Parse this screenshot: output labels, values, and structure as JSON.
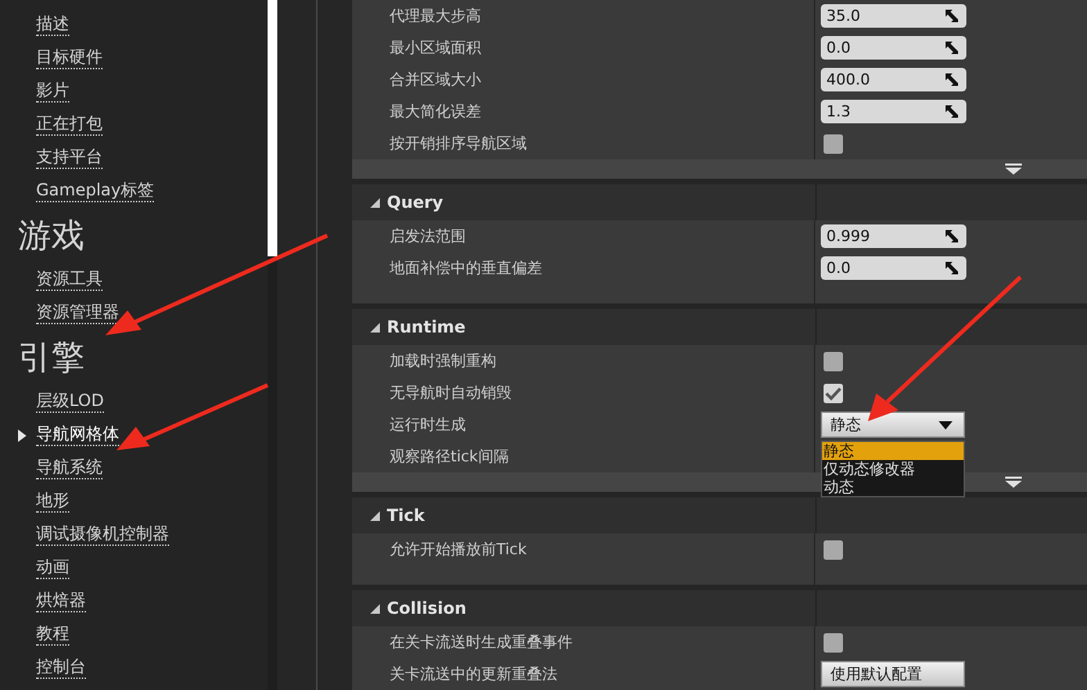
{
  "sidebar": {
    "sections": [
      {
        "items": [
          {
            "label": "描述",
            "selected": false
          },
          {
            "label": "目标硬件",
            "selected": false
          },
          {
            "label": "影片",
            "selected": false
          },
          {
            "label": "正在打包",
            "selected": false
          },
          {
            "label": "支持平台",
            "selected": false
          },
          {
            "label": "Gameplay标签",
            "selected": false
          }
        ]
      },
      {
        "heading": "游戏",
        "items": [
          {
            "label": "资源工具",
            "selected": false
          },
          {
            "label": "资源管理器",
            "selected": false
          }
        ]
      },
      {
        "heading": "引擎",
        "items": [
          {
            "label": "层级LOD",
            "selected": false
          },
          {
            "label": "导航网格体",
            "selected": true
          },
          {
            "label": "导航系统",
            "selected": false
          },
          {
            "label": "地形",
            "selected": false
          },
          {
            "label": "调试摄像机控制器",
            "selected": false
          },
          {
            "label": "动画",
            "selected": false
          },
          {
            "label": "烘焙器",
            "selected": false
          },
          {
            "label": "教程",
            "selected": false
          },
          {
            "label": "控制台",
            "selected": false
          }
        ]
      }
    ]
  },
  "details": {
    "categories": [
      {
        "advanced": true,
        "rows": [
          {
            "label": "代理最大步高",
            "kind": "number",
            "value": "35.0"
          },
          {
            "label": "最小区域面积",
            "kind": "number",
            "value": "0.0"
          },
          {
            "label": "合并区域大小",
            "kind": "number",
            "value": "400.0"
          },
          {
            "label": "最大简化误差",
            "kind": "number",
            "value": "1.3"
          },
          {
            "label": "按开销排序导航区域",
            "kind": "checkbox",
            "checked": false
          }
        ]
      },
      {
        "title": "Query",
        "expanded": true,
        "rows": [
          {
            "label": "启发法范围",
            "kind": "number",
            "value": "0.999"
          },
          {
            "label": "地面补偿中的垂直偏差",
            "kind": "number",
            "value": "0.0"
          }
        ]
      },
      {
        "title": "Runtime",
        "expanded": true,
        "advanced": true,
        "rows": [
          {
            "label": "加载时强制重构",
            "kind": "checkbox",
            "checked": false
          },
          {
            "label": "无导航时自动销毁",
            "kind": "checkbox",
            "checked": true
          },
          {
            "label": "运行时生成",
            "kind": "dropdown",
            "value": "静态",
            "open": true,
            "options": [
              {
                "label": "静态",
                "selected": true
              },
              {
                "label": "仅动态修改器",
                "selected": false
              },
              {
                "label": "动态",
                "selected": false
              }
            ]
          },
          {
            "label": "观察路径tick间隔",
            "kind": "empty"
          }
        ]
      },
      {
        "title": "Tick",
        "expanded": true,
        "rows": [
          {
            "label": "允许开始播放前Tick",
            "kind": "checkbox",
            "checked": false
          }
        ]
      },
      {
        "title": "Collision",
        "expanded": true,
        "rows": [
          {
            "label": "在关卡流送时生成重叠事件",
            "kind": "checkbox",
            "checked": false
          },
          {
            "label": "关卡流送中的更新重叠法",
            "kind": "button",
            "value": "使用默认配置"
          }
        ]
      }
    ]
  }
}
